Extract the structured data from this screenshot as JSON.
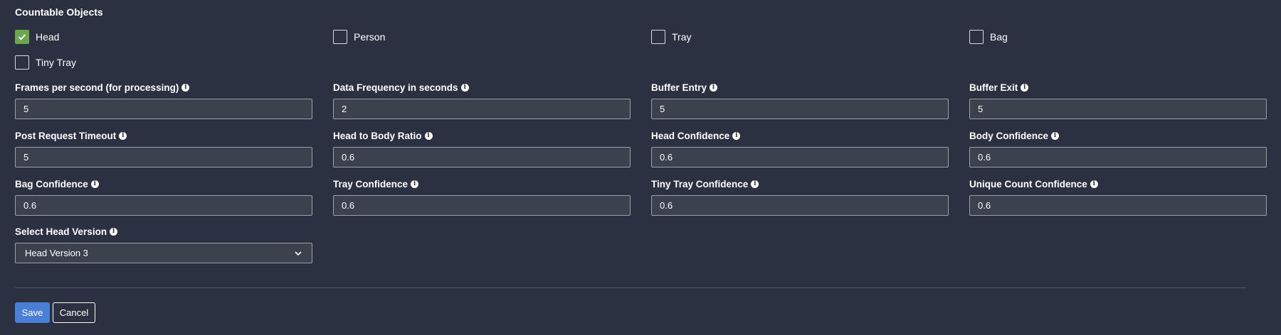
{
  "countable": {
    "title": "Countable Objects",
    "items": [
      {
        "label": "Head",
        "checked": true
      },
      {
        "label": "Person",
        "checked": false
      },
      {
        "label": "Tray",
        "checked": false
      },
      {
        "label": "Bag",
        "checked": false
      },
      {
        "label": "Tiny Tray",
        "checked": false
      }
    ]
  },
  "fields": [
    {
      "label": "Frames per second (for processing)",
      "value": "5"
    },
    {
      "label": "Data Frequency in seconds",
      "value": "2"
    },
    {
      "label": "Buffer Entry",
      "value": "5"
    },
    {
      "label": "Buffer Exit",
      "value": "5"
    },
    {
      "label": "Post Request Timeout",
      "value": "5"
    },
    {
      "label": "Head to Body Ratio",
      "value": "0.6"
    },
    {
      "label": "Head Confidence",
      "value": "0.6"
    },
    {
      "label": "Body Confidence",
      "value": "0.6"
    },
    {
      "label": "Bag Confidence",
      "value": "0.6"
    },
    {
      "label": "Tray Confidence",
      "value": "0.6"
    },
    {
      "label": "Tiny Tray Confidence",
      "value": "0.6"
    },
    {
      "label": "Unique Count Confidence",
      "value": "0.6"
    }
  ],
  "head_version": {
    "label": "Select Head Version",
    "selected": "Head Version 3"
  },
  "actions": {
    "save_label": "Save",
    "cancel_label": "Cancel"
  },
  "icons": {
    "info": "info-icon",
    "check": "check-icon",
    "chevron": "chevron-down-icon"
  },
  "colors": {
    "background": "#2b3140",
    "input_background": "#3b414d",
    "checked": "#6aa84f",
    "primary": "#4a7fd8"
  }
}
